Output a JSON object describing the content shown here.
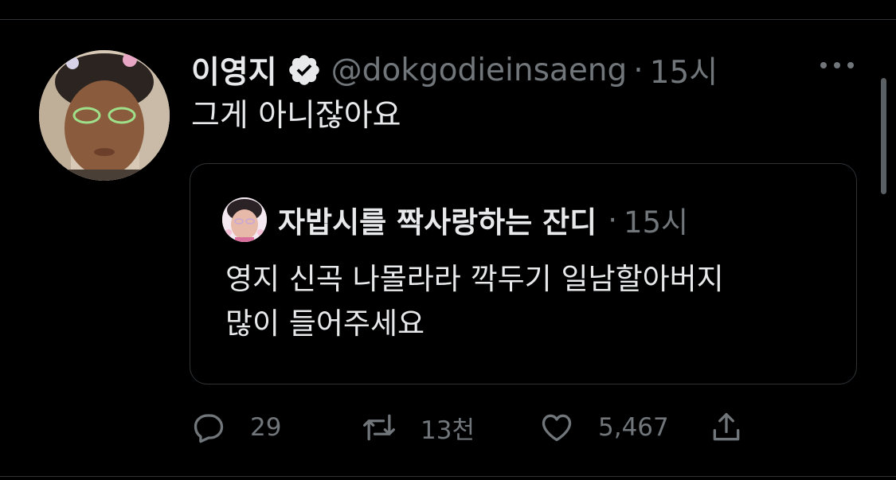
{
  "tweet": {
    "author": {
      "display_name": "이영지",
      "handle": "@dokgodieinsaeng",
      "avatar": "person-avatar",
      "verified_icon": "verified-badge-icon"
    },
    "separator": "·",
    "time": "15시",
    "text": "그게 아니잖아요",
    "more_icon": "more-horizontal-icon"
  },
  "quote": {
    "author": {
      "display_name": "자밥시를 짝사랑하는 잔디",
      "avatar": "person-avatar"
    },
    "separator": "·",
    "time": "15시",
    "text": "영지 신곡 나몰라라 깍두기 일남할아버지\n많이 들어주세요"
  },
  "actions": {
    "reply": {
      "icon": "reply-icon",
      "count": "29"
    },
    "retweet": {
      "icon": "retweet-icon",
      "count": "13천"
    },
    "like": {
      "icon": "heart-icon",
      "count": "5,467"
    },
    "share": {
      "icon": "share-icon"
    }
  },
  "colors": {
    "background": "#000000",
    "text_primary": "#e7e9ea",
    "text_secondary": "#71767b",
    "border": "#2f3336"
  }
}
